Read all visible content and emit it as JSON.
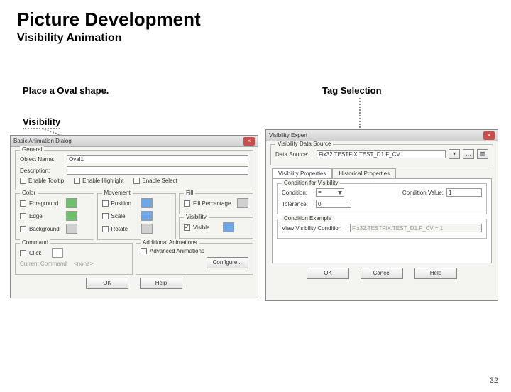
{
  "title": "Picture Development",
  "subtitle": "Visibility Animation",
  "labels": {
    "placeOval": "Place a Oval shape.",
    "tagSelection": "Tag Selection",
    "visibility": "Visibility"
  },
  "leftDialog": {
    "title": "Basic Animation Dialog",
    "general": {
      "legend": "General",
      "objectNameLabel": "Object Name:",
      "objectName": "Oval1",
      "descriptionLabel": "Description:",
      "enableTooltip": "Enable Tooltip",
      "enableHighlight": "Enable Highlight",
      "enableSelect": "Enable Select"
    },
    "cols": {
      "color": {
        "legend": "Color",
        "foreground": "Foreground",
        "edge": "Edge",
        "background": "Background"
      },
      "movement": {
        "legend": "Movement",
        "position": "Position",
        "scale": "Scale",
        "rotate": "Rotate"
      },
      "fill": {
        "legend": "Fill",
        "fillPercentage": "Fill Percentage"
      },
      "visibility": {
        "legend": "Visibility",
        "visible": "Visible"
      }
    },
    "command": {
      "legend": "Command",
      "click": "Click",
      "currentCommand": "Current Command:",
      "none": "<none>"
    },
    "additional": {
      "legend": "Additional Animations",
      "advanced": "Advanced Animations",
      "configure": "Configure..."
    },
    "okBtn": "OK",
    "helpBtn": "Help"
  },
  "rightDialog": {
    "title": "Visibility Expert",
    "dataSource": {
      "legend": "Visibility Data Source",
      "label": "Data Source:",
      "value": "Fix32.TESTFIX.TEST_D1.F_CV"
    },
    "tabs": {
      "active": "Visibility Properties",
      "other": "Historical Properties"
    },
    "conditionLegend": "Condition for Visibility",
    "conditionLabel": "Condition:",
    "conditionOp": "=",
    "conditionValueLabel": "Condition Value:",
    "conditionValue": "1",
    "toleranceLabel": "Tolerance:",
    "tolerance": "0",
    "exampleLegend": "Condition Example",
    "viewLabel": "View Visibility Condition",
    "viewValue": "Fix32.TESTFIX.TEST_D1.F_CV = 1",
    "okBtn": "OK",
    "cancelBtn": "Cancel",
    "helpBtn": "Help"
  },
  "pageNumber": "32"
}
